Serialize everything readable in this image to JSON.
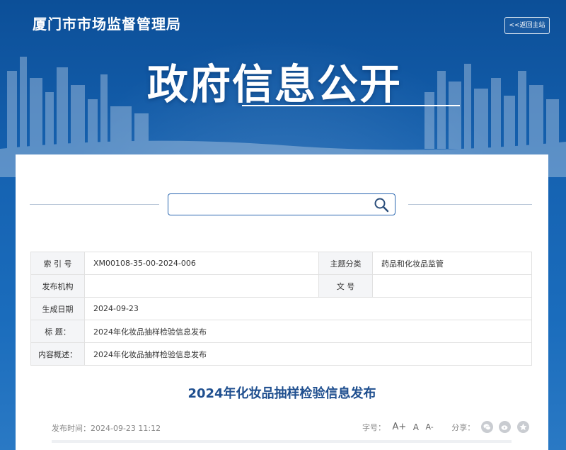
{
  "header": {
    "site_name": "厦门市市场监督管理局",
    "back_label": "<<返回主站",
    "hero_title": "政府信息公开"
  },
  "search": {
    "placeholder": "",
    "value": ""
  },
  "meta": {
    "index_label": "索 引 号",
    "index_value": "XM00108-35-00-2024-006",
    "topic_label": "主题分类",
    "topic_value": "药品和化妆品监管",
    "publisher_label": "发布机构",
    "publisher_value": "",
    "docno_label": "文    号",
    "docno_value": "",
    "date_label": "生成日期",
    "date_value": "2024-09-23",
    "title_label": "标    题：",
    "title_value": "2024年化妆品抽样检验信息发布",
    "summary_label": "内容概述：",
    "summary_value": "2024年化妆品抽样检验信息发布"
  },
  "article": {
    "title": "2024年化妆品抽样检验信息发布",
    "publish_time": "发布时间：2024-09-23 11:12",
    "font_size_label": "字号：",
    "font_sizes": [
      "A+",
      "A",
      "A-"
    ],
    "share_label": "分享："
  },
  "colors": {
    "banner": "#1a5fa8",
    "accent": "#1f4f8f",
    "search_border": "#2a67b0"
  }
}
